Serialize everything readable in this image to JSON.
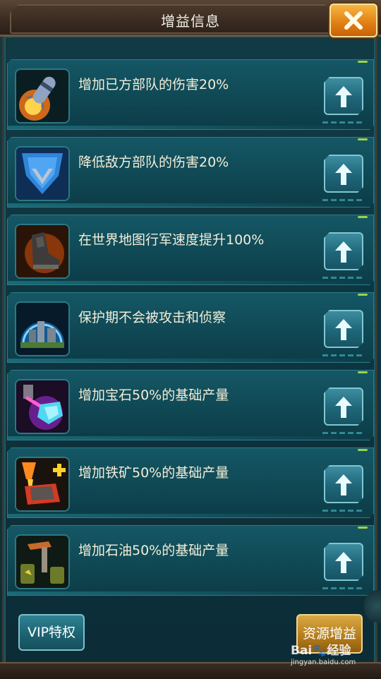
{
  "header": {
    "title": "增益信息"
  },
  "close": {
    "icon": "close-x-icon"
  },
  "buffs": [
    {
      "icon": "missile-icon",
      "text": "增加已方部队的伤害20%"
    },
    {
      "icon": "shield-icon",
      "text": "降低敌方部队的伤害20%"
    },
    {
      "icon": "boot-icon",
      "text": "在世界地图行军速度提升100%"
    },
    {
      "icon": "dome-city-icon",
      "text": "保护期不会被攻击和侦察"
    },
    {
      "icon": "gem-drill-icon",
      "text": "增加宝石50%的基础产量"
    },
    {
      "icon": "iron-forge-icon",
      "text": "增加铁矿50%的基础产量"
    },
    {
      "icon": "oil-pump-icon",
      "text": "增加石油50%的基础产量"
    }
  ],
  "footer": {
    "vip_label": "VIP特权",
    "resource_label": "资源增益"
  },
  "watermark": {
    "main": "Bai🐾经验",
    "url": "jingyan.baidu.com"
  },
  "colors": {
    "panel": "#0f4753",
    "accent_orange": "#e07d13",
    "button_teal": "#1f6679",
    "text": "#f4eed8"
  }
}
